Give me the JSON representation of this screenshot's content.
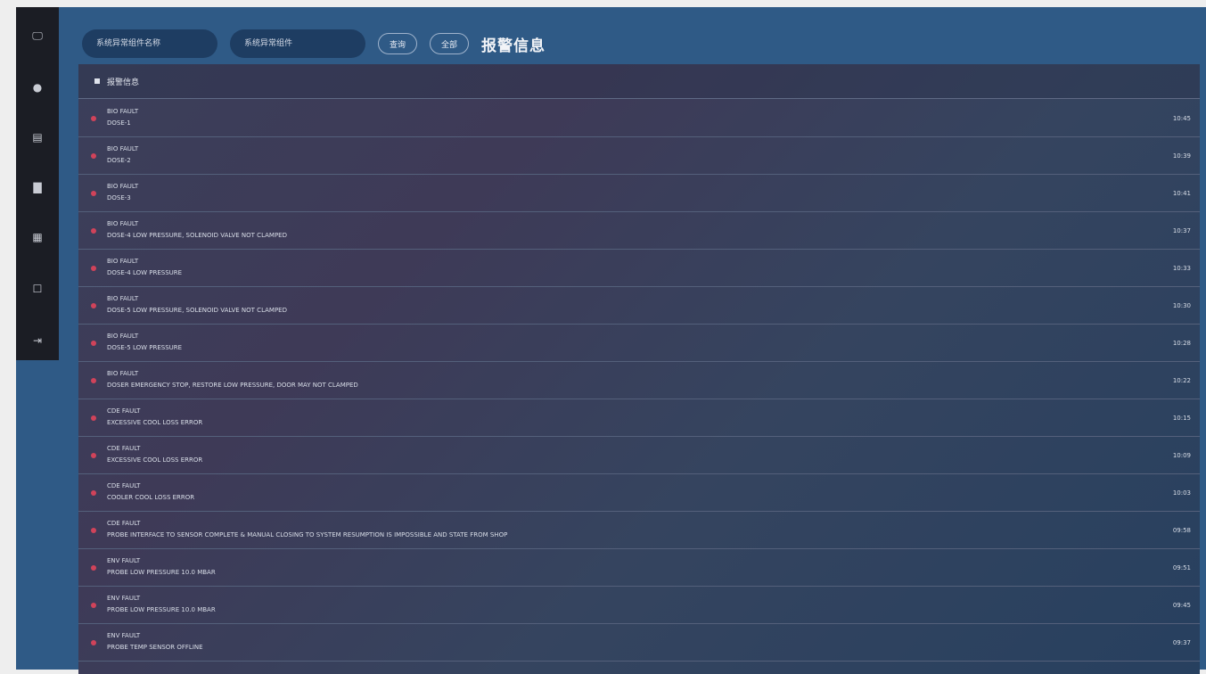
{
  "sidebar": {
    "items": [
      {
        "icon": "monitor-icon",
        "glyph": "🖵"
      },
      {
        "icon": "gauge-icon",
        "glyph": "●"
      },
      {
        "icon": "folder-icon",
        "glyph": "▤"
      },
      {
        "icon": "document-icon",
        "glyph": "▇"
      },
      {
        "icon": "report-icon",
        "glyph": "▦"
      },
      {
        "icon": "calendar-icon",
        "glyph": "☐"
      },
      {
        "icon": "logout-icon",
        "glyph": "⇥"
      }
    ]
  },
  "toolbar": {
    "input1_placeholder": "系统异常组件名称",
    "input2_placeholder": "系统异常组件",
    "query_label": "查询",
    "all_label": "全部",
    "title": "报警信息"
  },
  "panel": {
    "header_label": "报警信息"
  },
  "logs": [
    {
      "code": "BIO FAULT",
      "message": "DOSE-1",
      "time": "10:45"
    },
    {
      "code": "BIO FAULT",
      "message": "DOSE-2",
      "time": "10:39"
    },
    {
      "code": "BIO FAULT",
      "message": "DOSE-3",
      "time": "10:41"
    },
    {
      "code": "BIO FAULT",
      "message": "DOSE-4 LOW PRESSURE, SOLENOID VALVE NOT CLAMPED",
      "time": "10:37"
    },
    {
      "code": "BIO FAULT",
      "message": "DOSE-4 LOW PRESSURE",
      "time": "10:33"
    },
    {
      "code": "BIO FAULT",
      "message": "DOSE-5 LOW PRESSURE, SOLENOID VALVE NOT CLAMPED",
      "time": "10:30"
    },
    {
      "code": "BIO FAULT",
      "message": "DOSE-5 LOW PRESSURE",
      "time": "10:28"
    },
    {
      "code": "BIO FAULT",
      "message": "DOSER EMERGENCY STOP, RESTORE LOW PRESSURE, DOOR MAY NOT CLAMPED",
      "time": "10:22"
    },
    {
      "code": "CDE FAULT",
      "message": "EXCESSIVE COOL LOSS ERROR",
      "time": "10:15"
    },
    {
      "code": "CDE FAULT",
      "message": "EXCESSIVE COOL LOSS ERROR",
      "time": "10:09"
    },
    {
      "code": "CDE FAULT",
      "message": "COOLER COOL LOSS ERROR",
      "time": "10:03"
    },
    {
      "code": "CDE FAULT",
      "message": "PROBE INTERFACE TO SENSOR COMPLETE & MANUAL CLOSING TO SYSTEM RESUMPTION IS IMPOSSIBLE AND STATE FROM SHOP",
      "time": "09:58"
    },
    {
      "code": "ENV FAULT",
      "message": "PROBE LOW PRESSURE 10.0 MBAR",
      "time": "09:51"
    },
    {
      "code": "ENV FAULT",
      "message": "PROBE LOW PRESSURE 10.0 MBAR",
      "time": "09:45"
    },
    {
      "code": "ENV FAULT",
      "message": "PROBE TEMP SENSOR OFFLINE",
      "time": "09:37"
    }
  ],
  "colors": {
    "app_bg": "#2f5a86",
    "sidebar_bg": "#1b1d24",
    "alarm_dot": "#d0435a"
  }
}
